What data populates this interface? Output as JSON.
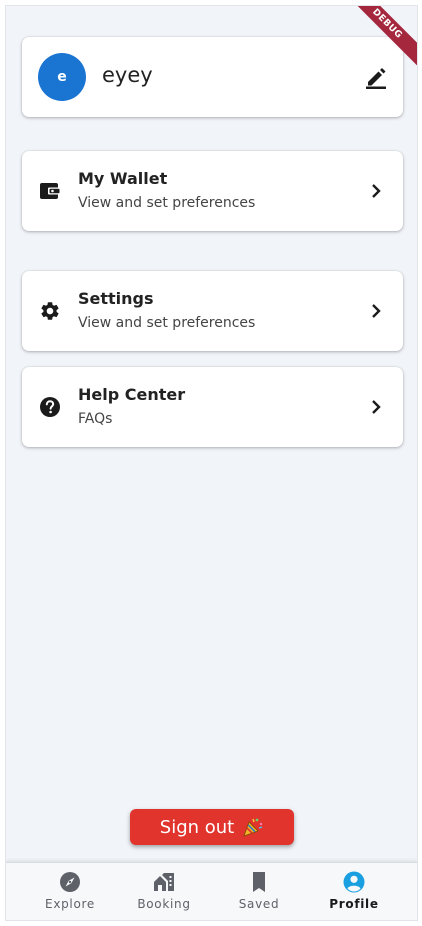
{
  "debug_banner": "DEBUG",
  "profile": {
    "avatar_letter": "e",
    "username": "eyey"
  },
  "menu": [
    {
      "title": "My Wallet",
      "subtitle": "View and set preferences",
      "icon": "wallet-icon"
    },
    {
      "title": "Settings",
      "subtitle": "View and set preferences",
      "icon": "gear-icon"
    },
    {
      "title": "Help Center",
      "subtitle": "FAQs",
      "icon": "help-icon"
    }
  ],
  "signout": {
    "label": "Sign out"
  },
  "nav": [
    {
      "label": "Explore",
      "icon": "compass-icon"
    },
    {
      "label": "Booking",
      "icon": "houses-icon"
    },
    {
      "label": "Saved",
      "icon": "bookmark-icon"
    },
    {
      "label": "Profile",
      "icon": "person-icon",
      "active": true
    }
  ],
  "colors": {
    "background": "#f1f4f9",
    "avatar": "#1a74d2",
    "signout": "#e0342c",
    "active_nav": "#1aa0e0",
    "debug": "#a4273e"
  }
}
